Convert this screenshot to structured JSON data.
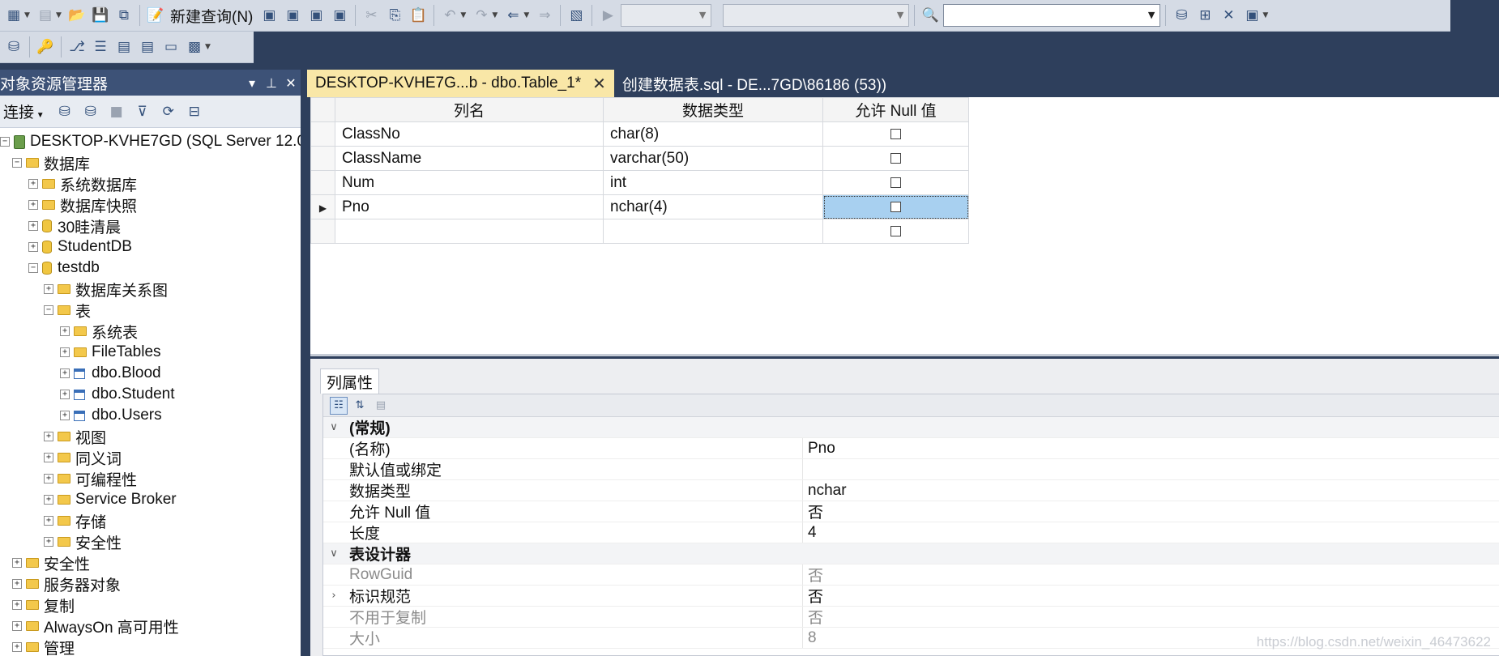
{
  "toolbar": {
    "new_query_label": "新建查询(N)",
    "combo_empty": ""
  },
  "object_explorer": {
    "title": "对象资源管理器",
    "connect_label": "连接",
    "tree": {
      "server": "DESKTOP-KVHE7GD (SQL Server 12.0.2000",
      "databases": "数据库",
      "system_databases": "系统数据库",
      "db_snapshots": "数据库快照",
      "db_30": "30眭清晨",
      "db_student": "StudentDB",
      "db_testdb": "testdb",
      "db_diagrams": "数据库关系图",
      "tables": "表",
      "system_tables": "系统表",
      "file_tables": "FileTables",
      "t_blood": "dbo.Blood",
      "t_student": "dbo.Student",
      "t_users": "dbo.Users",
      "views": "视图",
      "synonyms": "同义词",
      "programmability": "可编程性",
      "service_broker": "Service Broker",
      "storage": "存储",
      "db_security": "安全性",
      "security": "安全性",
      "server_objects": "服务器对象",
      "replication": "复制",
      "alwayson": "AlwaysOn 高可用性",
      "management": "管理"
    }
  },
  "tabs": {
    "active": "DESKTOP-KVHE7G...b - dbo.Table_1*",
    "inactive": "创建数据表.sql - DE...7GD\\86186 (53))"
  },
  "designer": {
    "headers": {
      "column_name": "列名",
      "data_type": "数据类型",
      "allow_null": "允许 Null 值"
    },
    "rows": [
      {
        "name": "ClassNo",
        "type": "char(8)"
      },
      {
        "name": "ClassName",
        "type": "varchar(50)"
      },
      {
        "name": "Num",
        "type": "int"
      },
      {
        "name": "Pno",
        "type": "nchar(4)"
      },
      {
        "name": "",
        "type": ""
      }
    ]
  },
  "properties": {
    "tab_label": "列属性",
    "cat_general": "(常规)",
    "name_label": "(名称)",
    "name_value": "Pno",
    "default_label": "默认值或绑定",
    "default_value": "",
    "type_label": "数据类型",
    "type_value": "nchar",
    "null_label": "允许 Null 值",
    "null_value": "否",
    "length_label": "长度",
    "length_value": "4",
    "cat_designer": "表设计器",
    "rowguid_label": "RowGuid",
    "rowguid_value": "否",
    "identity_label": "标识规范",
    "identity_value": "否",
    "repl_label": "不用于复制",
    "repl_value": "否",
    "size_label": "大小",
    "size_value": "8"
  },
  "watermark": "https://blog.csdn.net/weixin_46473622"
}
